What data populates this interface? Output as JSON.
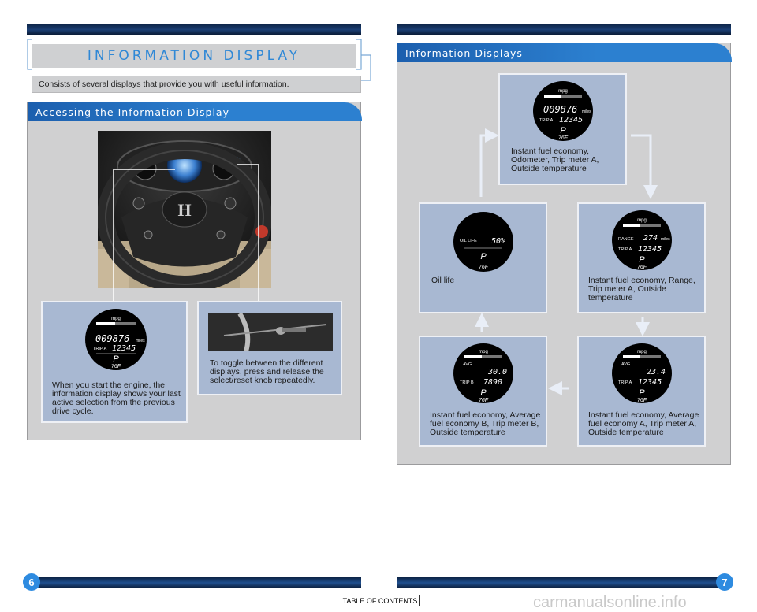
{
  "left": {
    "title": "INFORMATION DISPLAY",
    "subtitle": "Consists of several displays that provide you with useful information.",
    "panel_title": "Accessing the Information Display",
    "card1_text": "When you start the engine, the information display shows your last active selection from the previous drive cycle.",
    "card2_text": "To toggle between the different displays, press and release the select/reset knob repeatedly.",
    "page_number": "6"
  },
  "right": {
    "panel_title": "Information Displays",
    "cards": [
      {
        "text": "Instant fuel economy, Odometer, Trip meter A, Outside temperature"
      },
      {
        "text": "Oil life"
      },
      {
        "text": "Instant fuel economy, Range, Trip meter A, Outside temperature"
      },
      {
        "text": "Instant fuel economy, Average fuel economy B, Trip meter B, Outside temperature"
      },
      {
        "text": "Instant fuel economy, Average fuel economy A, Trip meter A, Outside temperature"
      }
    ],
    "page_number": "7"
  },
  "gauges": {
    "mpg": "mpg",
    "odometer": "009876",
    "miles": "miles",
    "trip_a_label": "TRIP A",
    "trip_b_label": "TRIP B",
    "trip_a_value": "12345",
    "trip_b_value": "7890",
    "gear": "P",
    "temp": "76F",
    "range_label": "RANGE",
    "range_value": "274",
    "avg_label": "AVG",
    "avg_b_value": "30.0",
    "avg_a_value": "23.4",
    "oil_label": "OIL LIFE",
    "oil_value": "50%"
  },
  "footer": {
    "toc": "TABLE OF CONTENTS",
    "watermark": "carmanualsonline.info"
  }
}
